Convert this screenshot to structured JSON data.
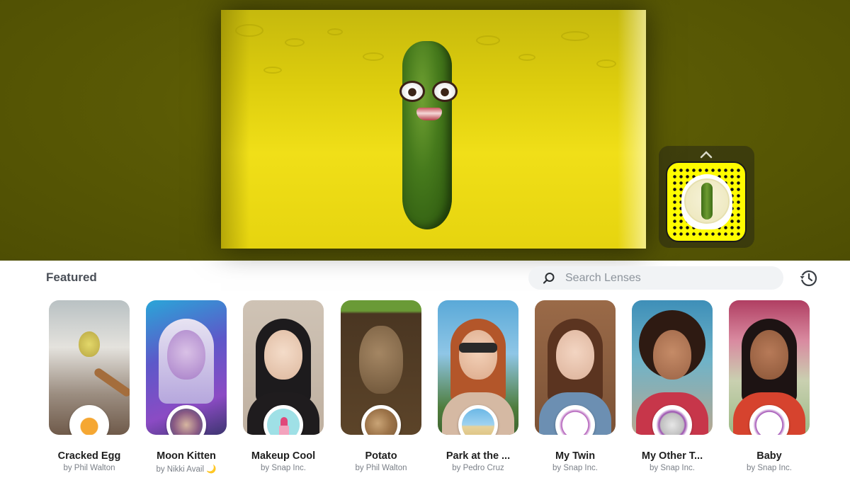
{
  "featured": {
    "title": "Featured"
  },
  "search": {
    "placeholder": "Search Lenses"
  },
  "lenses": [
    {
      "name": "Cracked Egg",
      "author": "by Phil Walton"
    },
    {
      "name": "Moon Kitten",
      "author": "by Nikki Avail 🌙"
    },
    {
      "name": "Makeup Cool",
      "author": "by Snap Inc."
    },
    {
      "name": "Potato",
      "author": "by Phil Walton"
    },
    {
      "name": "Park at the ...",
      "author": "by Pedro Cruz"
    },
    {
      "name": "My Twin",
      "author": "by Snap Inc."
    },
    {
      "name": "My Other T...",
      "author": "by Snap Inc."
    },
    {
      "name": "Baby",
      "author": "by Snap Inc."
    }
  ],
  "icons": {
    "search": "search-icon",
    "history": "history-icon",
    "snapcode_toggle": "chevron-up-icon"
  },
  "colors": {
    "preview_background": "#5a5a05",
    "snapcode_yellow": "#fffc00",
    "search_background": "#f1f3f5"
  }
}
